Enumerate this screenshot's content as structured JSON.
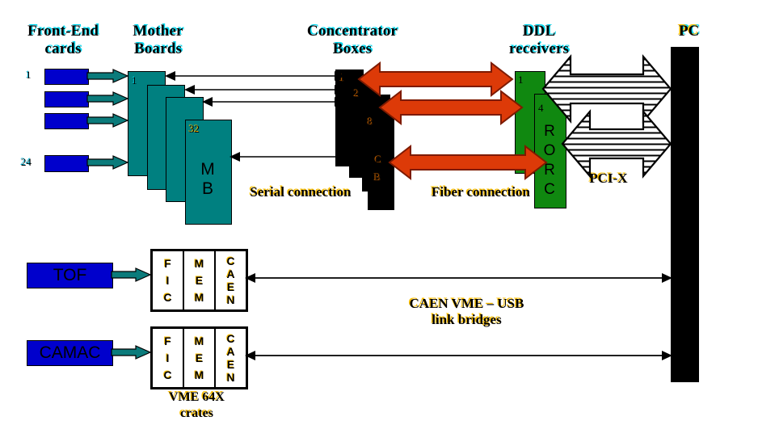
{
  "headers": {
    "front_end": "Front-End\ncards",
    "mother_boards": "Mother\nBoards",
    "concentrator": "Concentrator\nBoxes",
    "ddl": "DDL\nreceivers",
    "pc": "PC"
  },
  "front_end_cards": {
    "first_index": "1",
    "last_index": "24",
    "count_shown": 4
  },
  "mother_boards": {
    "first_index": "1",
    "last_index": "32",
    "body_label_line1": "M",
    "body_label_line2": "B"
  },
  "concentrator_boxes": {
    "index_1": "1",
    "index_2": "2",
    "index_8": "8",
    "letter_c": "C",
    "letter_b": "B"
  },
  "ddl_receivers": {
    "index_1": "1",
    "index_4": "4",
    "rorc_letters": [
      "R",
      "O",
      "R",
      "C"
    ]
  },
  "connection_labels": {
    "serial": "Serial connection",
    "fiber": "Fiber connection",
    "pci_x": "PCI-X",
    "caen_usb": "CAEN VME – USB\nlink bridges"
  },
  "lower_section": {
    "tof_label": "TOF",
    "camac_label": "CAMAC",
    "crate_caption": "VME 64X\ncrates",
    "crate_columns": [
      {
        "name": "fic",
        "letters": [
          "F",
          "I",
          "C"
        ]
      },
      {
        "name": "mem",
        "letters": [
          "M",
          "E",
          "M"
        ]
      },
      {
        "name": "caen",
        "letters": [
          "C",
          "A",
          "E",
          "N"
        ]
      }
    ]
  },
  "colors": {
    "blue_card": "#0000cc",
    "teal_board": "#008080",
    "black_box": "#000000",
    "green_ddl": "#108810",
    "orange_fiber": "#dd3a08",
    "orange_fiber_stroke": "#7d1a00",
    "teal_arrow": "#0b7b7b",
    "header_shadow": "#00d8f0",
    "gold_shadow": "#ffc000"
  }
}
